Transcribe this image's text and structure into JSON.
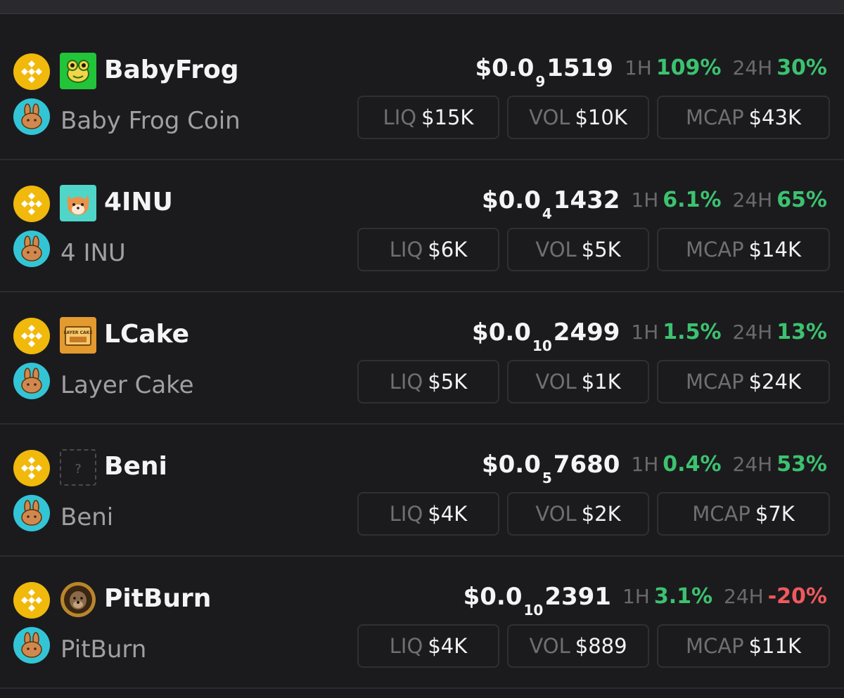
{
  "tokens": [
    {
      "symbol": "BabyFrog",
      "name": "Baby Frog Coin",
      "avatar_icon": "frog-icon",
      "price_prefix": "$0.0",
      "price_zeros": "9",
      "price_digits": "1519",
      "h1_label": "1H",
      "h1_change": "109%",
      "h24_label": "24H",
      "h24_change": "30%",
      "liq_label": "LIQ",
      "liq": "$15K",
      "vol_label": "VOL",
      "vol": "$10K",
      "mcap_label": "MCAP",
      "mcap": "$43K"
    },
    {
      "symbol": "4INU",
      "name": "4 INU",
      "avatar_icon": "shiba-dog-icon",
      "price_prefix": "$0.0",
      "price_zeros": "4",
      "price_digits": "1432",
      "h1_label": "1H",
      "h1_change": "6.1%",
      "h24_label": "24H",
      "h24_change": "65%",
      "liq_label": "LIQ",
      "liq": "$6K",
      "vol_label": "VOL",
      "vol": "$5K",
      "mcap_label": "MCAP",
      "mcap": "$14K"
    },
    {
      "symbol": "LCake",
      "name": "Layer Cake",
      "avatar_icon": "layer-cake-icon",
      "avatar_text": "LAYER CAKE",
      "price_prefix": "$0.0",
      "price_zeros": "10",
      "price_digits": "2499",
      "h1_label": "1H",
      "h1_change": "1.5%",
      "h24_label": "24H",
      "h24_change": "13%",
      "liq_label": "LIQ",
      "liq": "$5K",
      "vol_label": "VOL",
      "vol": "$1K",
      "mcap_label": "MCAP",
      "mcap": "$24K"
    },
    {
      "symbol": "Beni",
      "name": "Beni",
      "avatar_icon": "question-mark-icon",
      "avatar_text": "?",
      "price_prefix": "$0.0",
      "price_zeros": "5",
      "price_digits": "7680",
      "h1_label": "1H",
      "h1_change": "0.4%",
      "h24_label": "24H",
      "h24_change": "53%",
      "liq_label": "LIQ",
      "liq": "$4K",
      "vol_label": "VOL",
      "vol": "$2K",
      "mcap_label": "MCAP",
      "mcap": "$7K"
    },
    {
      "symbol": "PitBurn",
      "name": "PitBurn",
      "avatar_icon": "pitbull-coin-icon",
      "price_prefix": "$0.0",
      "price_zeros": "10",
      "price_digits": "2391",
      "h1_label": "1H",
      "h1_change": "3.1%",
      "h24_label": "24H",
      "h24_change": "-20%",
      "liq_label": "LIQ",
      "liq": "$4K",
      "vol_label": "VOL",
      "vol": "$889",
      "mcap_label": "MCAP",
      "mcap": "$11K"
    }
  ],
  "chain_icon": "bnb-chain-icon",
  "dex_icon": "pancakeswap-bunny-icon",
  "colors": {
    "background": "#1b1b1e",
    "positive": "#3cc26f",
    "negative": "#f0595c",
    "bnb_yellow": "#f0b90b",
    "pancake_cyan": "#33c5d6"
  }
}
